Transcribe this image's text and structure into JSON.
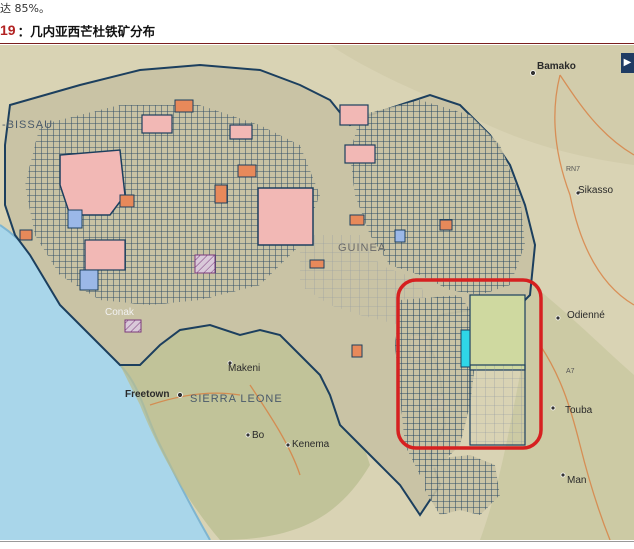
{
  "page": {
    "top_fragment": "达 85%。",
    "figure_number": "19",
    "figure_caption": "：几内亚西芒杜铁矿分布"
  },
  "map": {
    "labels": {
      "bamako": "Bamako",
      "bissau": "-BISSAU",
      "rn7": "RN7",
      "sikasso": "Sikasso",
      "guinea": "GUINEA",
      "conakry": "Conak",
      "odienne": "Odienné",
      "a7": "A7",
      "makeni": "Makeni",
      "freetown": "Freetown",
      "sierra_leone": "SIERRA LEONE",
      "bo": "Bo",
      "kenema": "Kenema",
      "touba": "Touba",
      "man": "Man"
    },
    "colors": {
      "ocean": "#a9d6ea",
      "land": "#dcd6b8",
      "highlight": "#d62020",
      "tenement_outline": "#1c3f5e",
      "tenement_pink": "#f2b8b5",
      "tenement_orange": "#e8895a",
      "tenement_blue": "#9bb8e8",
      "cyan_block": "#2fd6e8"
    },
    "scroll_tab_icon": "chevron-right-icon"
  }
}
